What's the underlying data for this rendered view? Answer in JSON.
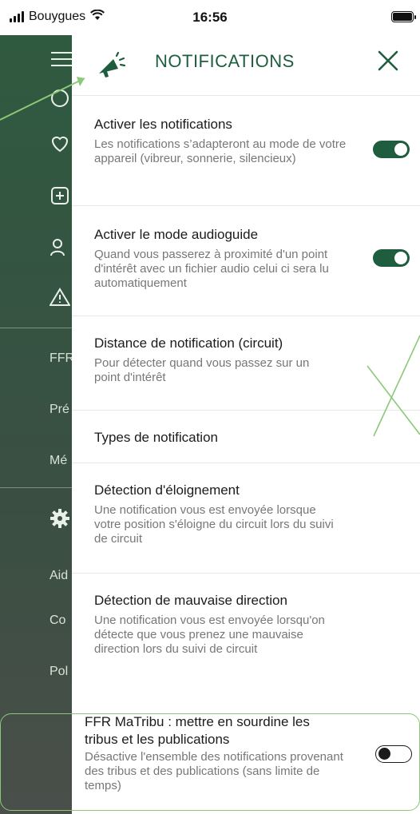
{
  "status_bar": {
    "carrier": "Bouygues",
    "time": "16:56"
  },
  "sidebar": {
    "texts": [
      "FFR",
      "Pré",
      "Mé",
      "Aid",
      "Co",
      "Pol"
    ]
  },
  "header": {
    "title": "NOTIFICATIONS"
  },
  "settings": [
    {
      "title": "Activer les notifications",
      "description": "Les notifications s’adapteront au mode de votre appareil (vibreur, sonnerie, silencieux)",
      "toggle": "on"
    },
    {
      "title": "Activer le mode audioguide",
      "description": "Quand vous passerez à proximité d'un point d'intérêt avec un fichier audio celui ci sera lu automatiquement",
      "toggle": "on"
    },
    {
      "title": "Distance de notification (circuit)",
      "description": "Pour détecter quand vous passez sur un point d'intérêt"
    },
    {
      "title": "Types de notification"
    },
    {
      "title": "Détection d'éloignement",
      "description": "Une notification vous est envoyée lorsque votre position s'éloigne du circuit lors du suivi de circuit"
    },
    {
      "title": "Détection de mauvaise direction",
      "description": "Une notification vous est envoyée lorsqu'on détecte que vous prenez une mauvaise direction lors du suivi de circuit"
    },
    {
      "title": "FFR MaTribu : mettre en sourdine les tribus et les publications",
      "description": "Désactive l'ensemble des notifications provenant des tribus et des publications (sans limite de temps)",
      "toggle": "off"
    }
  ],
  "colors": {
    "accent": "#1f5d3f",
    "annotation": "#8bc878"
  },
  "icons": {
    "menu": "menu-icon",
    "megaphone": "megaphone-icon",
    "close": "close-icon"
  }
}
